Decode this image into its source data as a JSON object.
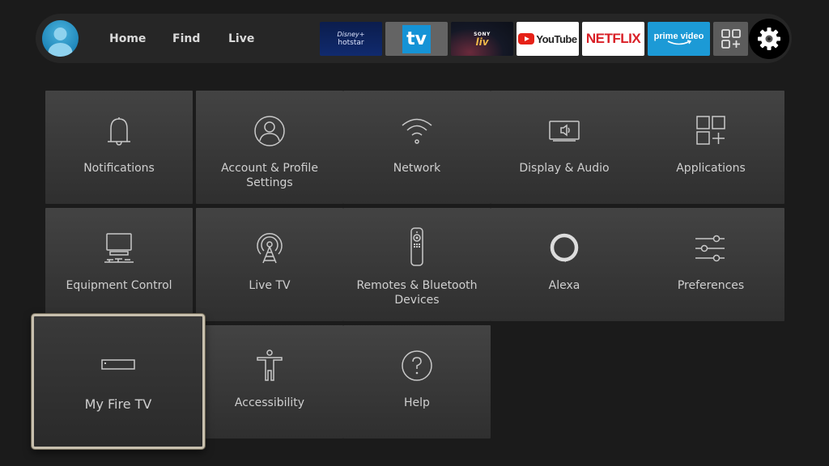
{
  "topbar": {
    "profile_icon": "profile-avatar-icon",
    "nav": [
      {
        "label": "Home"
      },
      {
        "label": "Find"
      },
      {
        "label": "Live"
      }
    ],
    "apps": [
      {
        "name": "Disney+ Hotstar",
        "line1": "Disney+",
        "line2": "hotstar"
      },
      {
        "name": "TV",
        "label": "tv"
      },
      {
        "name": "Sony LIV",
        "line1": "SONY",
        "line2": "liv"
      },
      {
        "name": "YouTube",
        "label": "YouTube"
      },
      {
        "name": "Netflix",
        "label": "NETFLIX"
      },
      {
        "name": "Prime Video",
        "label": "prime video"
      },
      {
        "name": "All Apps",
        "icon": "apps-grid-plus-icon"
      }
    ],
    "settings_icon": "gear-icon"
  },
  "settings": {
    "tiles": [
      {
        "label": "Notifications",
        "icon": "bell-icon"
      },
      {
        "label": "Account & Profile Settings",
        "icon": "user-circle-icon"
      },
      {
        "label": "Network",
        "icon": "wifi-icon"
      },
      {
        "label": "Display & Audio",
        "icon": "display-speaker-icon"
      },
      {
        "label": "Applications",
        "icon": "apps-icon"
      },
      {
        "label": "Equipment Control",
        "icon": "tv-equipment-icon"
      },
      {
        "label": "Live TV",
        "icon": "antenna-icon"
      },
      {
        "label": "Remotes & Bluetooth Devices",
        "icon": "remote-icon"
      },
      {
        "label": "Alexa",
        "icon": "alexa-ring-icon"
      },
      {
        "label": "Preferences",
        "icon": "sliders-icon"
      },
      {
        "label": "My Fire TV",
        "icon": "fire-tv-stick-icon",
        "focused": true
      },
      {
        "label": "Accessibility",
        "icon": "accessibility-person-icon"
      },
      {
        "label": "Help",
        "icon": "help-circle-icon"
      }
    ]
  },
  "colors": {
    "background": "#1b1b1b",
    "focus_border": "#c8c0ae",
    "netflix_red": "#d91f26",
    "prime_blue": "#1c9ad6",
    "youtube_red": "#e62117"
  }
}
